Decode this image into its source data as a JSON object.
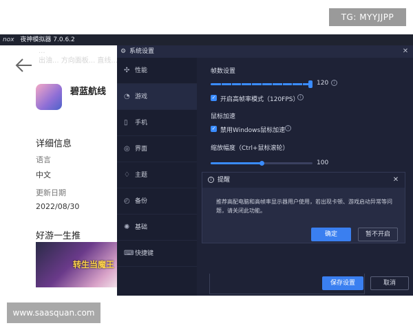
{
  "watermarks": {
    "tg": "TG: MYYJJPP",
    "site": "www.saasquan.com"
  },
  "emulator": {
    "logo": "nox",
    "title": "夜神模拟器 7.0.6.2"
  },
  "app_page": {
    "faded_lines": [
      "...",
      "出油... 方向面板... 直线..."
    ],
    "game_name": "碧蓝航线",
    "detail_title": "详细信息",
    "language_label": "语言",
    "language_value": "中文",
    "update_label": "更新日期",
    "update_value": "2022/08/30",
    "recommend_title": "好游一生推",
    "promo_text": "转生当魔王"
  },
  "settings": {
    "title": "系统设置",
    "nav": [
      {
        "label": "性能",
        "icon": "performance-icon"
      },
      {
        "label": "游戏",
        "icon": "game-icon"
      },
      {
        "label": "手机",
        "icon": "phone-icon"
      },
      {
        "label": "界面",
        "icon": "interface-icon"
      },
      {
        "label": "主题",
        "icon": "theme-icon"
      },
      {
        "label": "备份",
        "icon": "backup-icon"
      },
      {
        "label": "基础",
        "icon": "basic-icon"
      },
      {
        "label": "快捷键",
        "icon": "shortcut-icon"
      }
    ],
    "active_nav": "游戏",
    "fps": {
      "title": "帧数设置",
      "value": "120",
      "fraction": 1.0,
      "high_fps_label": "开启高帧率模式（120FPS）",
      "high_fps_checked": true
    },
    "mouse": {
      "title": "鼠标加速",
      "disable_label": "禁用Windows鼠标加速",
      "disable_checked": true
    },
    "zoom": {
      "title": "缩放幅度（Ctrl+鼠标滚轮）",
      "value": "100",
      "fraction": 0.5
    },
    "save_label": "保存设置",
    "cancel_label": "取消"
  },
  "dialog": {
    "title": "提醒",
    "message": "推荐高配电脑和高帧率显示器用户使用，若出现卡顿、游戏启动异常等问题，请关闭此功能。",
    "confirm_label": "确定",
    "later_label": "暂不开启"
  },
  "colors": {
    "accent": "#3a8cff",
    "panel_bg": "#1c2035"
  }
}
